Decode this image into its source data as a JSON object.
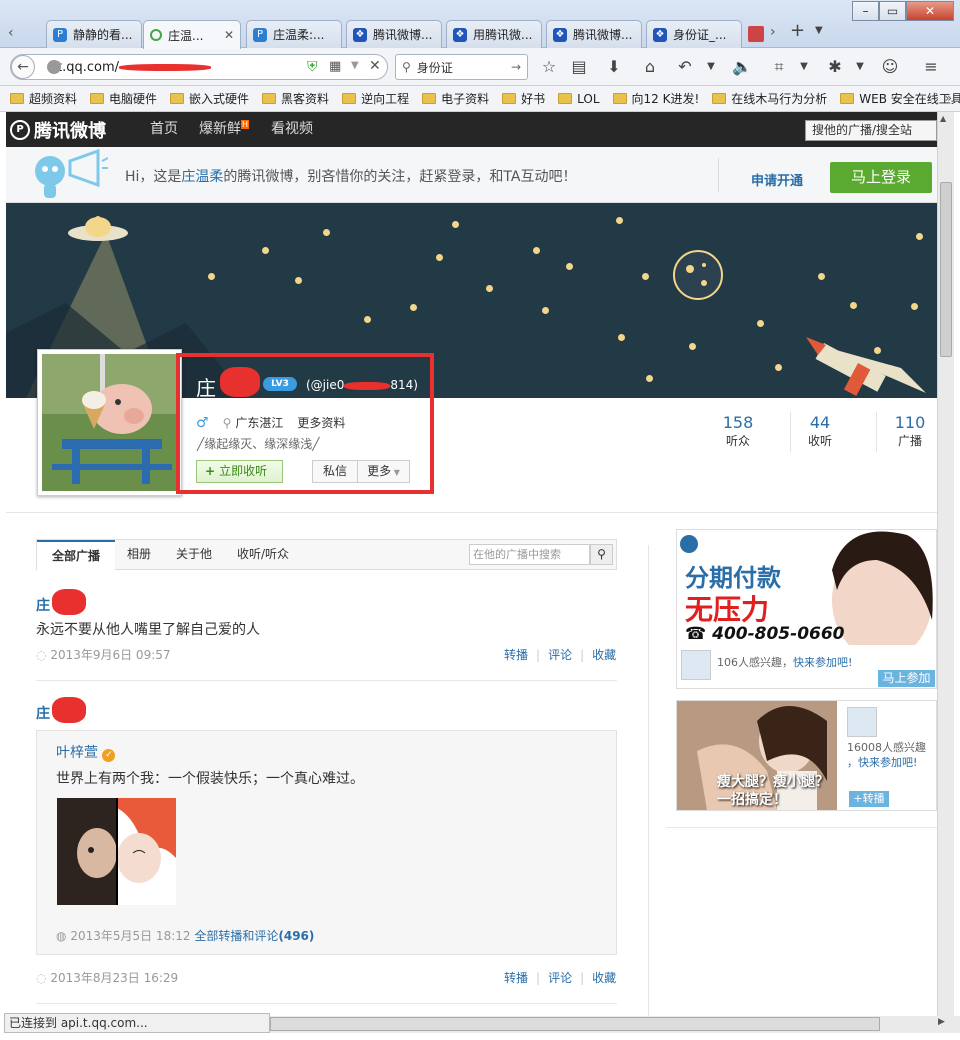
{
  "browser": {
    "tabs": [
      {
        "label": "静静的看...",
        "icon": "p-icon"
      },
      {
        "label": "庄温...",
        "icon": "loading-icon"
      },
      {
        "label": "庄温柔:...",
        "icon": "p-icon"
      },
      {
        "label": "腾讯微博...",
        "icon": "paw-icon"
      },
      {
        "label": "用腾讯微...",
        "icon": "paw-icon"
      },
      {
        "label": "腾讯微博...",
        "icon": "paw-icon"
      },
      {
        "label": "身份证_...",
        "icon": "paw-icon"
      }
    ],
    "url": "t.qq.com/",
    "search_value": "身份证",
    "bookmarks": [
      "超频资料",
      "电脑硬件",
      "嵌入式硬件",
      "黑客资料",
      "逆向工程",
      "电子资料",
      "好书",
      "LOL",
      "向12 K进发!",
      "在线木马行为分析",
      "WEB 安全在线工具"
    ],
    "status_text": "已连接到 api.t.qq.com..."
  },
  "site": {
    "logo": "腾讯微博",
    "nav": [
      "首页",
      "爆新鲜",
      "看视频"
    ],
    "hot_badge": "H",
    "search_placeholder": "搜他的广播/搜全站",
    "promo": {
      "before": "Hi，这是",
      "name": "庄温柔",
      "after": "的腾讯微博，别吝惜你的关注，赶紧登录，和TA互动吧！",
      "apply": "申请开通",
      "login": "马上登录"
    },
    "profile": {
      "name": "庄",
      "level": "LV3",
      "handle_prefix": "(@jie0",
      "handle_suffix": "814)",
      "location": "广东湛江",
      "more_info": "更多资料",
      "signature": "╱缘起缘灭、缘深缘浅╱",
      "follow": "立即收听",
      "message": "私信",
      "more": "更多"
    },
    "stats": [
      {
        "value": "158",
        "label": "听众"
      },
      {
        "value": "44",
        "label": "收听"
      },
      {
        "value": "110",
        "label": "广播"
      }
    ],
    "profile_tabs": [
      "全部广播",
      "相册",
      "关于他",
      "收听/听众"
    ],
    "profile_search_placeholder": "在他的广播中搜索",
    "posts": [
      {
        "author": "庄",
        "text": "永远不要从他人嘴里了解自己爱的人",
        "time": "2013年9月6日 09:57",
        "actions": [
          "转播",
          "评论",
          "收藏"
        ]
      },
      {
        "author": "庄",
        "time": "2013年8月23日 16:29",
        "actions": [
          "转播",
          "评论",
          "收藏"
        ],
        "repost": {
          "author": "叶梓萱",
          "text": "世界上有两个我：一个假装快乐；一个真心难过。",
          "time": "2013年5月5日 18:12",
          "link": "全部转播和评论",
          "count": "(496)"
        }
      }
    ],
    "ads": [
      {
        "title": "分期付款",
        "headline": "无压力",
        "phone": "400-805-0660",
        "interest": "106人感兴趣，",
        "cta": "快来参加吧!",
        "button": "马上参加"
      },
      {
        "caption1": "瘦大腿？瘦小腿？",
        "caption2": "一招搞定！",
        "interest": "16008人感兴趣",
        "cta": "，快来参加吧!",
        "button": "+转播"
      }
    ]
  },
  "colors": {
    "accent": "#2a6ea8",
    "green": "#5aaa32",
    "highlight": "#e8302e",
    "banner": "#223946"
  }
}
